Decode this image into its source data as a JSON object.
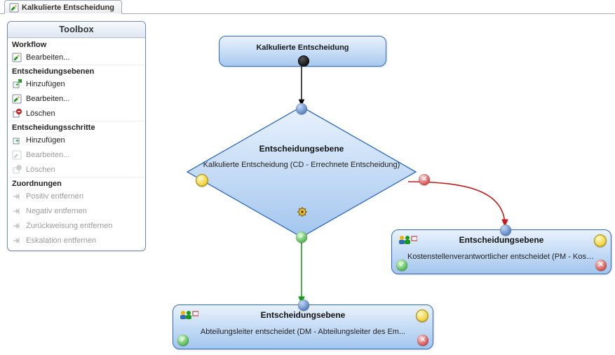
{
  "tab": {
    "title": "Kalkulierte Entscheidung"
  },
  "toolbox": {
    "title": "Toolbox",
    "sections": [
      {
        "title": "Workflow",
        "items": [
          {
            "label": "Bearbeiten...",
            "icon": "edit-icon",
            "enabled": true
          }
        ]
      },
      {
        "title": "Entscheidungsebenen",
        "items": [
          {
            "label": "Hinzufügen",
            "icon": "add-icon",
            "enabled": true
          },
          {
            "label": "Bearbeiten...",
            "icon": "edit-icon",
            "enabled": true
          },
          {
            "label": "Löschen",
            "icon": "delete-icon",
            "enabled": true
          }
        ]
      },
      {
        "title": "Entscheidungsschritte",
        "items": [
          {
            "label": "Hinzufügen",
            "icon": "add-icon",
            "enabled": true
          },
          {
            "label": "Bearbeiten...",
            "icon": "edit-icon",
            "enabled": false
          },
          {
            "label": "Löschen",
            "icon": "delete-icon",
            "enabled": false
          }
        ]
      },
      {
        "title": "Zuordnungen",
        "items": [
          {
            "label": "Positiv entfernen",
            "icon": "unassign-icon",
            "enabled": false
          },
          {
            "label": "Negativ entfernen",
            "icon": "unassign-icon",
            "enabled": false
          },
          {
            "label": "Zurückweisung entfernen",
            "icon": "unassign-icon",
            "enabled": false
          },
          {
            "label": "Eskalation entfernen",
            "icon": "unassign-icon",
            "enabled": false
          }
        ]
      }
    ]
  },
  "diagram": {
    "start": {
      "title": "Kalkulierte Entscheidung"
    },
    "decision": {
      "title": "Entscheidungsebene",
      "subtitle": "Kalkulierte Entscheidung (CD - Errechnete Entscheidung)"
    },
    "box_left": {
      "title": "Entscheidungsebene",
      "subtitle": "Abteilungsleiter entscheidet (DM - Abteilungsleiter des Em..."
    },
    "box_right": {
      "title": "Entscheidungsebene",
      "subtitle": "Kostenstellenverantwortlicher entscheidet (PM - Kostenstel..."
    }
  },
  "colors": {
    "accent": "#2e6bbf",
    "success": "#1a9a1a",
    "danger": "#c41a1a",
    "warn": "#e7c200"
  }
}
